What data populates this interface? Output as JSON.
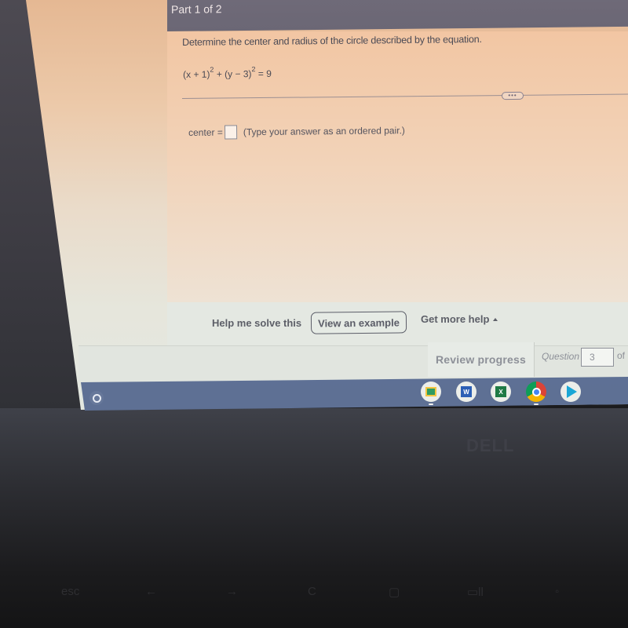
{
  "question": {
    "part_label": "Part 1 of 2",
    "prompt": "Determine the center and radius of the circle described by the equation.",
    "equation": {
      "term1": "(x + 1)",
      "exp1": "2",
      "plus": " + ",
      "term2": "(y − 3)",
      "exp2": "2",
      "rhs": " = 9"
    },
    "more_button_label": "•••",
    "answer": {
      "label": "center =",
      "value": "",
      "hint": "(Type your answer as an ordered pair.)"
    }
  },
  "help": {
    "help_me_solve": "Help me solve this",
    "view_example": "View an example",
    "get_more_help": "Get more help"
  },
  "footer": {
    "review_progress": "Review progress",
    "question_label": "Question",
    "question_number": "3",
    "of_label": "of"
  },
  "shelf": {
    "launcher_icon": "launcher-circle-icon",
    "apps": [
      {
        "name": "Google Classroom",
        "icon": "classroom-icon",
        "running": true
      },
      {
        "name": "Microsoft Word",
        "icon": "word-icon",
        "glyph": "W",
        "running": false
      },
      {
        "name": "Microsoft Excel",
        "icon": "excel-icon",
        "glyph": "X",
        "running": false
      },
      {
        "name": "Google Chrome",
        "icon": "chrome-icon",
        "running": true
      },
      {
        "name": "Google Play Store",
        "icon": "play-store-icon",
        "running": false
      }
    ]
  },
  "keyboard": {
    "keys": [
      "esc",
      "←",
      "→",
      "C",
      "▢",
      "▭ll",
      "◦"
    ]
  },
  "brand": "DELL",
  "colors": {
    "header_bg": "#6d6977",
    "panel_bg": "#f2c6a3",
    "shelf_bg": "#6476a0",
    "text": "#4a4a55"
  }
}
